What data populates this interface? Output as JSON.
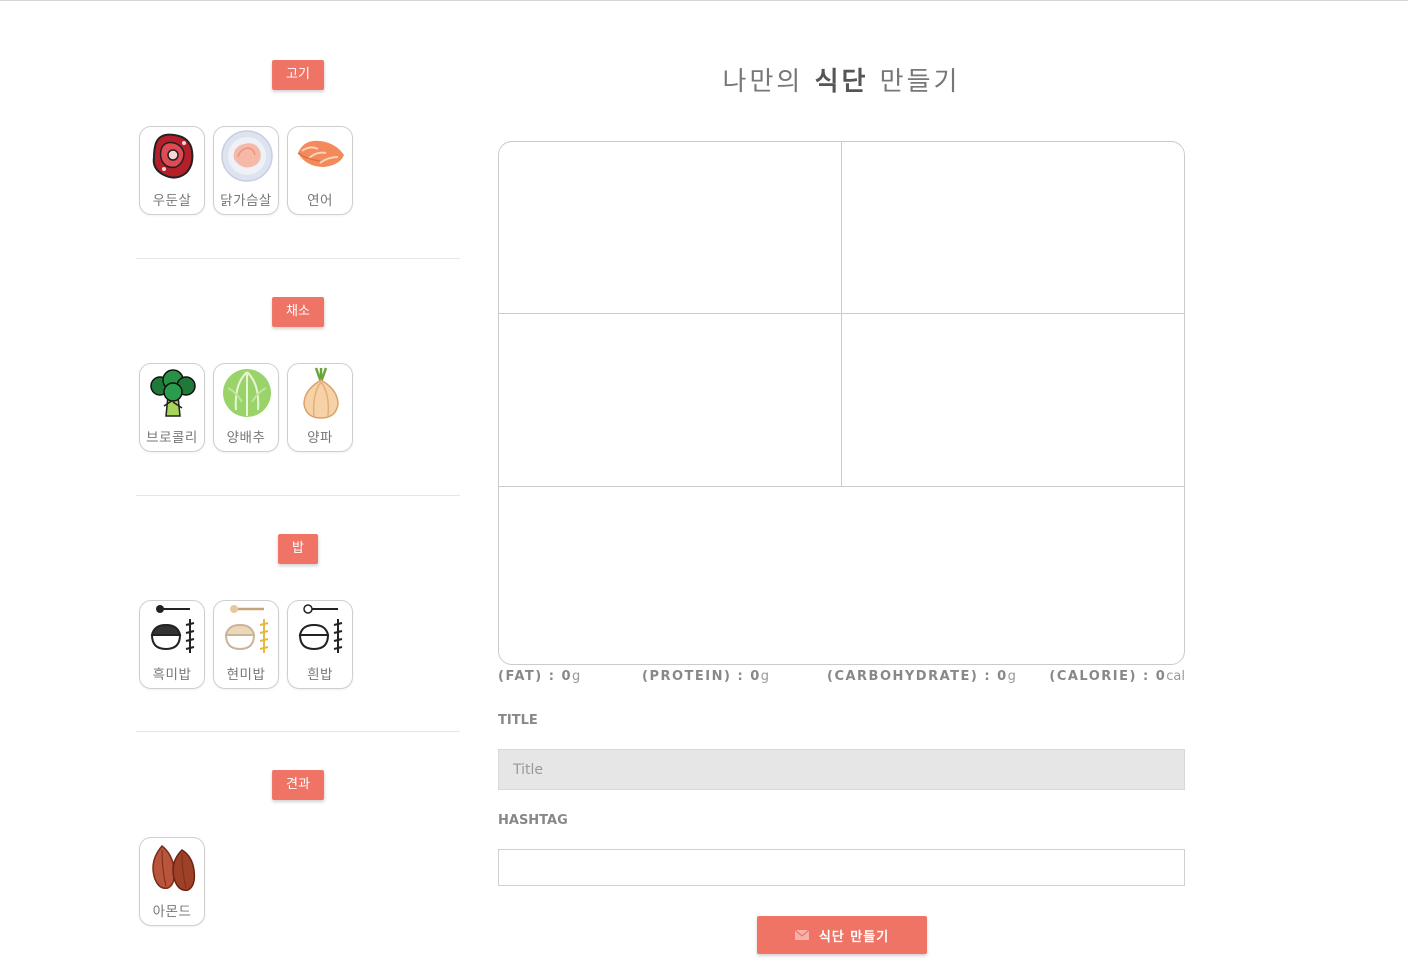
{
  "header": {
    "title_pre": "나만의 ",
    "title_bold": "식단",
    "title_post": " 만들기"
  },
  "categories": [
    {
      "label": "고기",
      "items": [
        {
          "label": "우둔살",
          "icon": "beef-steak-icon"
        },
        {
          "label": "닭가슴살",
          "icon": "chicken-breast-icon"
        },
        {
          "label": "연어",
          "icon": "salmon-icon"
        }
      ]
    },
    {
      "label": "채소",
      "items": [
        {
          "label": "브로콜리",
          "icon": "broccoli-icon"
        },
        {
          "label": "양배추",
          "icon": "cabbage-icon"
        },
        {
          "label": "양파",
          "icon": "onion-icon"
        }
      ]
    },
    {
      "label": "밥",
      "items": [
        {
          "label": "흑미밥",
          "icon": "black-rice-icon"
        },
        {
          "label": "현미밥",
          "icon": "brown-rice-icon"
        },
        {
          "label": "흰밥",
          "icon": "white-rice-icon"
        }
      ]
    },
    {
      "label": "견과",
      "items": [
        {
          "label": "아몬드",
          "icon": "almond-icon"
        }
      ]
    }
  ],
  "nutrition": {
    "fat": {
      "label": "(FAT) : ",
      "value": "0",
      "unit": "g"
    },
    "protein": {
      "label": "(PROTEIN) : ",
      "value": "0",
      "unit": "g"
    },
    "carbohydrate": {
      "label": "(CARBOHYDRATE) : ",
      "value": "0",
      "unit": "g"
    },
    "calorie": {
      "label": "(CALORIE) : ",
      "value": "0",
      "unit": "cal"
    }
  },
  "form": {
    "title_label": "TITLE",
    "title_placeholder": "Title",
    "hashtag_label": "HASHTAG",
    "hashtag_placeholder": ""
  },
  "submit": {
    "label": "식단 만들기",
    "icon": "envelope-icon"
  },
  "colors": {
    "accent": "#ef7466",
    "text": "#777777",
    "border": "#cbcbcb"
  }
}
